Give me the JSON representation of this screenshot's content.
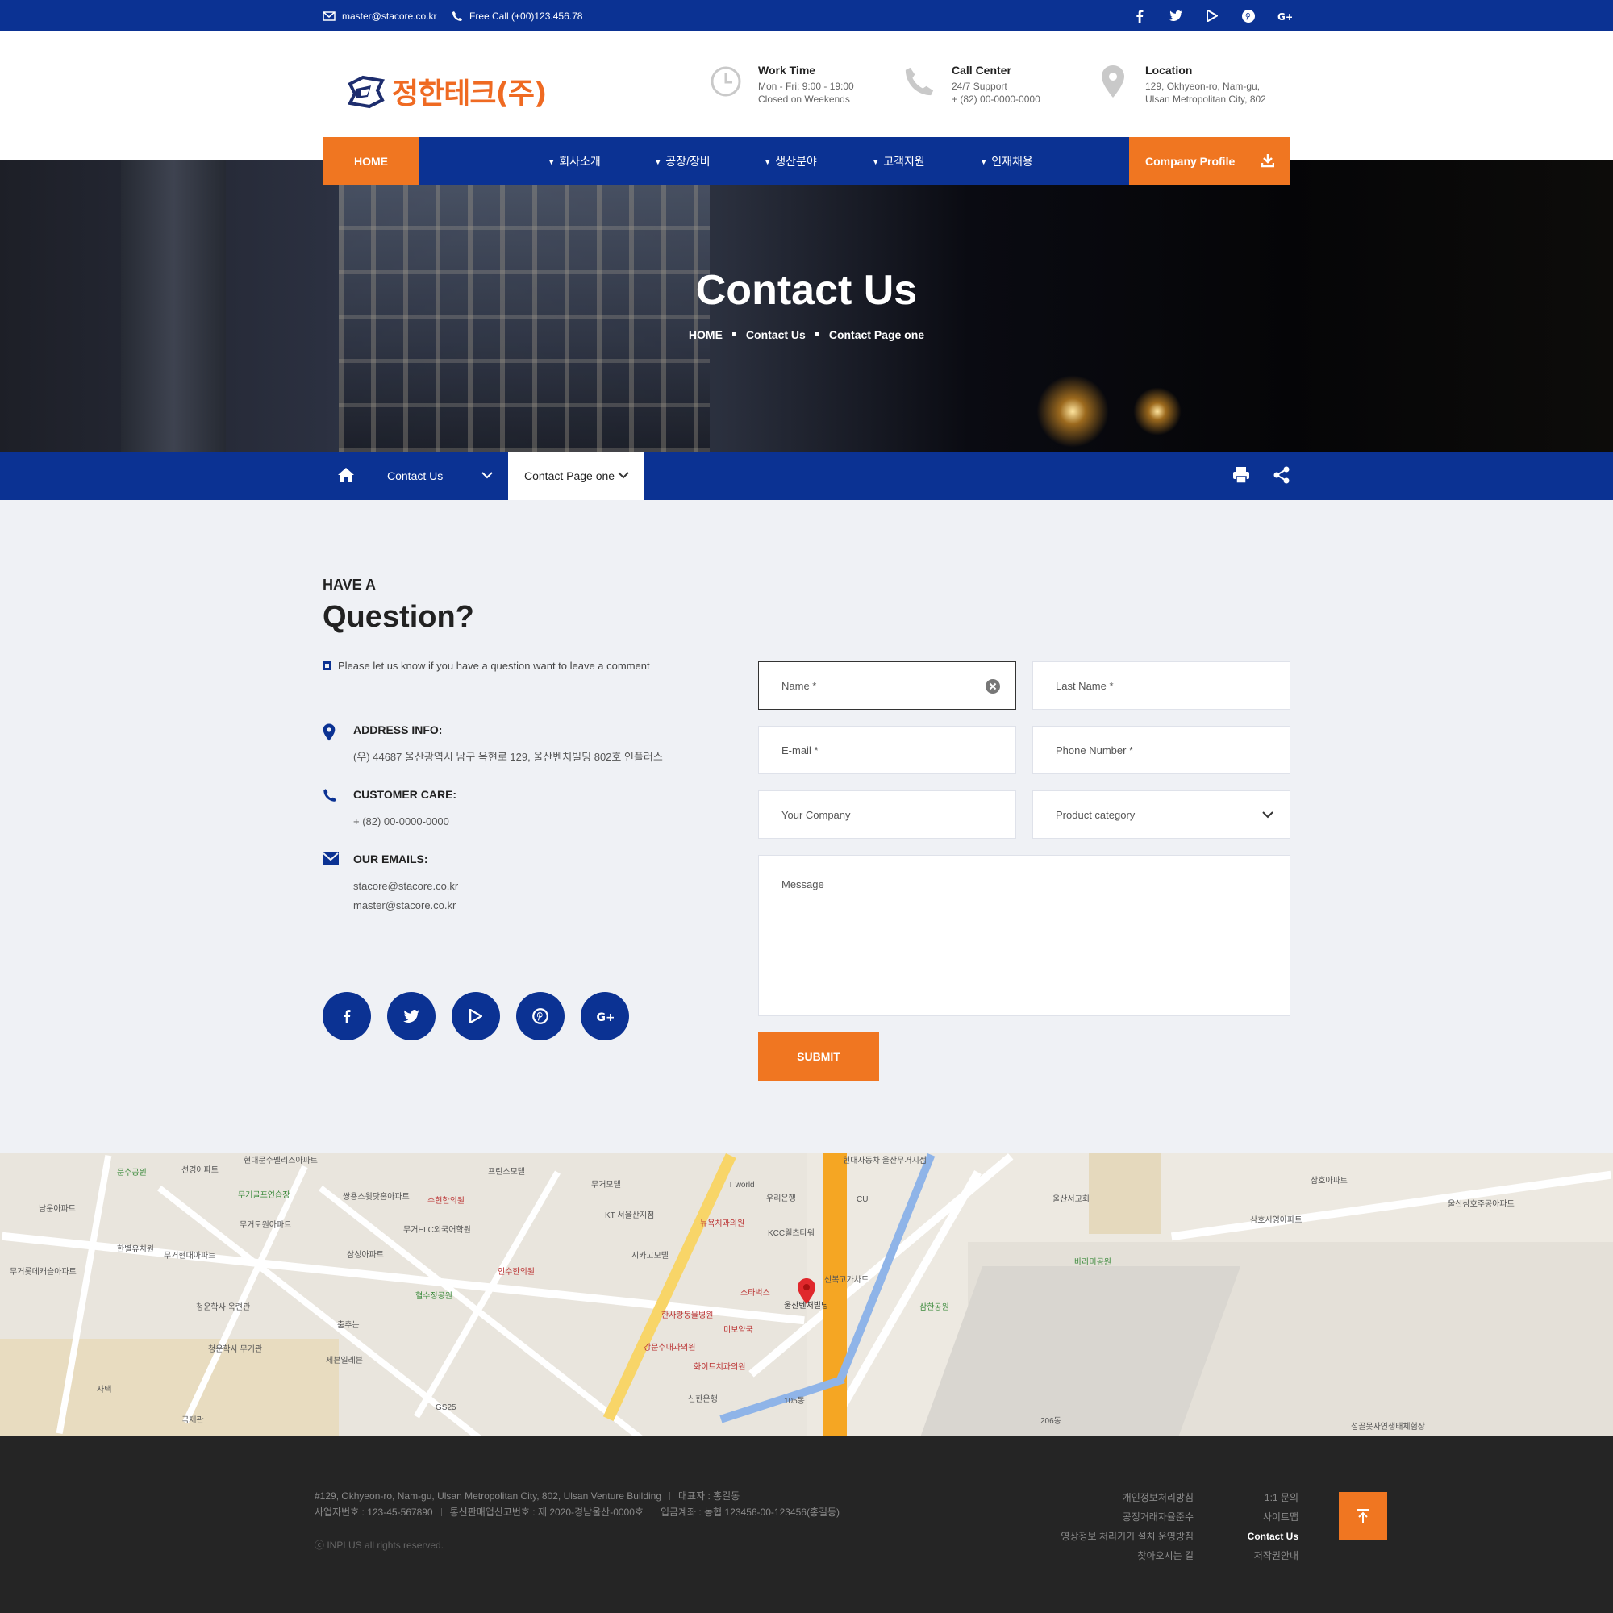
{
  "topbar": {
    "email": "master@stacore.co.kr",
    "phone": "Free Call (+00)123.456.78",
    "social_icons": [
      "facebook-icon",
      "twitter-icon",
      "google-play-icon",
      "pinterest-icon",
      "google-plus-icon"
    ]
  },
  "header": {
    "logo_text": "정한테크(주)",
    "work_time": {
      "title": "Work Time",
      "line1": "Mon - Fri: 9:00 - 19:00",
      "line2": "Closed on Weekends"
    },
    "call_center": {
      "title": "Call Center",
      "line1": "24/7 Support",
      "line2": "+ (82) 00-0000-0000"
    },
    "location": {
      "title": "Location",
      "line1": "129, Okhyeon-ro, Nam-gu,",
      "line2": "Ulsan Metropolitan City, 802"
    }
  },
  "nav": {
    "home": "HOME",
    "items": [
      "회사소개",
      "공장/장비",
      "생산분야",
      "고객지원",
      "인재채용"
    ],
    "profile": "Company Profile"
  },
  "hero": {
    "title": "Contact Us",
    "breadcrumb": [
      "HOME",
      "Contact Us",
      "Contact Page one"
    ]
  },
  "subnav": {
    "section": "Contact Us",
    "page": "Contact Page one"
  },
  "question": {
    "small": "HAVE A",
    "big": "Question?",
    "note": "Please let us know if you have a question want to leave a comment"
  },
  "contact": {
    "address": {
      "title": "ADDRESS INFO:",
      "text": "(우) 44687  울산광역시 남구 옥현로 129, 울산벤처빌딩 802호 인플러스"
    },
    "care": {
      "title": "CUSTOMER CARE:",
      "text": "+ (82) 00-0000-0000"
    },
    "emails": {
      "title": "OUR EMAILS:",
      "line1": "stacore@stacore.co.kr",
      "line2": "master@stacore.co.kr"
    }
  },
  "form": {
    "name": "Name *",
    "last_name": "Last Name *",
    "email": "E-mail *",
    "phone": "Phone Number *",
    "company": "Your Company",
    "category": "Product category",
    "message": "Message",
    "submit": "SUBMIT"
  },
  "map": {
    "labels": [
      "문수공원",
      "선경아파트",
      "현대문수펠리스아파트",
      "남운아파트",
      "무거골프연습장",
      "쌍용스윗닷홈아파트",
      "수현한의원",
      "프린스모텔",
      "무거모텔",
      "T world",
      "우리은행",
      "현대자동차 울산무거지점",
      "CU",
      "KT 서울산지점",
      "뉴욕치과의원",
      "KCC웰츠타워",
      "신복고가차도",
      "스타벅스",
      "울산벤처빌딩",
      "한사랑동물병원",
      "미보약국",
      "강문수내과의원",
      "신한은행",
      "삼한공원",
      "바라미공원",
      "울산서교회",
      "삼호시영아파트",
      "삼호아파트",
      "울산삼호주공아파트",
      "섬골못자연생태체험장",
      "무거도원아파트",
      "삼성아파트",
      "인수한의원",
      "혈수정공원",
      "청운학사 옥련관",
      "청운학사 무거관",
      "세븐일레븐",
      "국제관",
      "화이트치과의원",
      "무거현대아파트",
      "한별유치원",
      "무거롯데캐슬아파트",
      "시카고모텔",
      "무거ELC외국어학원",
      "춤추는",
      "사택",
      "GS25",
      "105동",
      "206동"
    ]
  },
  "footer": {
    "address": "#129, Okhyeon-ro, Nam-gu, Ulsan Metropolitan City, 802, Ulsan Venture Building",
    "ceo": "대표자 : 홍길동",
    "biz_no": "사업자번호 : 123-45-567890",
    "sales_no": "통신판매업신고번호 : 제 2020-경남울산-0000호",
    "account": "입금계좌 : 농협 123456-00-123456(홍길동)",
    "copyright": "ⓒ INPLUS all rights reserved.",
    "links1": [
      "개인정보처리방침",
      "공정거래자율준수",
      "영상정보 처리기기 설치 운영방침",
      "찾아오시는 길"
    ],
    "links2": [
      "1:1 문의",
      "사이트맵",
      "Contact Us",
      "저작권안내"
    ]
  },
  "colors": {
    "primary": "#0b3293",
    "accent": "#f07621",
    "footer_bg": "#252525"
  }
}
